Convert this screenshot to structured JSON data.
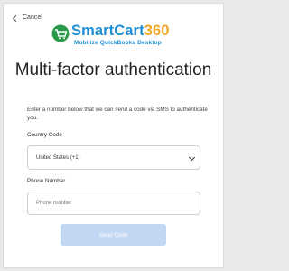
{
  "back": {
    "label": "Cancel"
  },
  "logo": {
    "brand_part1": "SmartCart",
    "brand_part2": "360",
    "tagline": "Mobilize QuickBooks Desktop"
  },
  "title": "Multi-factor authentication",
  "description": "Enter a number below that we can send a code via SMS to authenticate you.",
  "country": {
    "label": "Country Code",
    "selected": "United States (+1)"
  },
  "phone": {
    "label": "Phone Number",
    "placeholder": "Phone number"
  },
  "submit": {
    "label": "Send Code"
  },
  "colors": {
    "brand_blue": "#1e8fd6",
    "brand_orange": "#f4a623",
    "button_disabled": "#c2d7f4"
  }
}
